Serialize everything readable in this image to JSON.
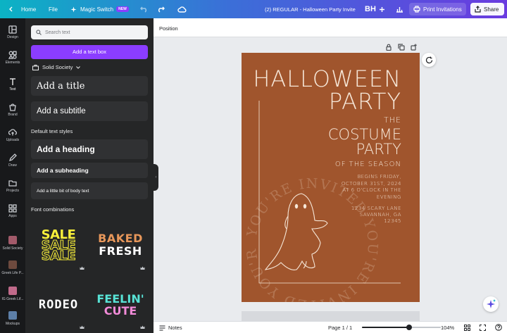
{
  "topbar": {
    "home_label": "Home",
    "file_label": "File",
    "magic_switch_label": "Magic Switch",
    "new_badge": "NEW",
    "doc_title": "(2) REGULAR - Halloween Party Invite",
    "avatar_initials": "BH",
    "print_label": "Print Invitations",
    "share_label": "Share"
  },
  "rail": {
    "items": [
      {
        "label": "Design",
        "icon": "design-icon"
      },
      {
        "label": "Elements",
        "icon": "elements-icon"
      },
      {
        "label": "Text",
        "icon": "text-icon"
      },
      {
        "label": "Brand",
        "icon": "brand-icon"
      },
      {
        "label": "Uploads",
        "icon": "uploads-icon"
      },
      {
        "label": "Draw",
        "icon": "draw-icon"
      },
      {
        "label": "Projects",
        "icon": "projects-icon"
      },
      {
        "label": "Apps",
        "icon": "apps-icon"
      },
      {
        "label": "Solid Society",
        "icon": "thumbnail"
      },
      {
        "label": "Greek Life P...",
        "icon": "thumbnail"
      },
      {
        "label": "IG Greek Lif...",
        "icon": "thumbnail"
      },
      {
        "label": "Mockups",
        "icon": "thumbnail"
      }
    ]
  },
  "panel": {
    "search_placeholder": "Search text",
    "add_text_box": "Add a text box",
    "brand_kit": "Solid Society",
    "add_title": "Add a title",
    "add_subtitle": "Add a subtitle",
    "default_styles": "Default text styles",
    "add_heading": "Add a heading",
    "add_subheading": "Add a subheading",
    "add_body": "Add a little bit of body text",
    "font_combinations": "Font combinations",
    "combos": {
      "sale": "SALE",
      "baked": "BAKED",
      "fresh": "FRESH",
      "rodeo": "RODEO",
      "feelin": "FEELIN'",
      "cute": "CUTE"
    }
  },
  "canvas": {
    "position_label": "Position"
  },
  "design": {
    "line1": "HALLOWEEN",
    "line2": "PARTY",
    "the": "THE",
    "costume": "COSTUME",
    "party2": "PARTY",
    "of_season": "OF THE SEASON",
    "details": [
      "BEGINS FRIDAY,",
      "OCTOBER 31ST, 2024",
      "AT 6 O'CLOCK IN THE",
      "EVENING"
    ],
    "address": [
      "1234 SCARY LANE",
      "SAVANNAH, GA",
      "12345"
    ],
    "arc_text": "YOU'RE INVITED YOU'RE INVITED YOU'RE INVITED"
  },
  "bottombar": {
    "notes_label": "Notes",
    "page_indicator": "Page 1 / 1",
    "zoom": "104%",
    "zoom_level": 0.6
  },
  "colors": {
    "accent": "#8b3dff",
    "page_bg": "#a0552d",
    "page_text": "#f6e7d8"
  }
}
